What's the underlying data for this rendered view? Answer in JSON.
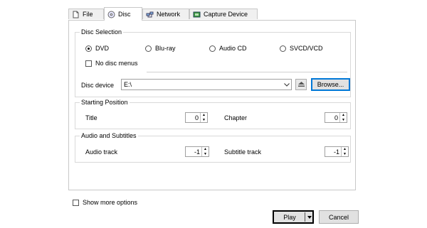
{
  "tabs": [
    {
      "label": "File",
      "icon": "file-icon"
    },
    {
      "label": "Disc",
      "icon": "disc-icon"
    },
    {
      "label": "Network",
      "icon": "network-icon"
    },
    {
      "label": "Capture Device",
      "icon": "capture-device-icon"
    }
  ],
  "disc_selection": {
    "title": "Disc Selection",
    "radios": [
      {
        "label": "DVD",
        "selected": true
      },
      {
        "label": "Blu-ray",
        "selected": false
      },
      {
        "label": "Audio CD",
        "selected": false
      },
      {
        "label": "SVCD/VCD",
        "selected": false
      }
    ],
    "no_menus_label": "No disc menus",
    "device_label": "Disc device",
    "device_value": "E:\\",
    "browse_label": "Browse..."
  },
  "starting_position": {
    "title": "Starting Position",
    "title_label": "Title",
    "title_value": "0",
    "chapter_label": "Chapter",
    "chapter_value": "0"
  },
  "audio_subtitles": {
    "title": "Audio and Subtitles",
    "audio_label": "Audio track",
    "audio_value": "-1",
    "subtitle_label": "Subtitle track",
    "subtitle_value": "-1"
  },
  "footer": {
    "show_more_label": "Show more options",
    "play_label": "Play",
    "cancel_label": "Cancel"
  }
}
